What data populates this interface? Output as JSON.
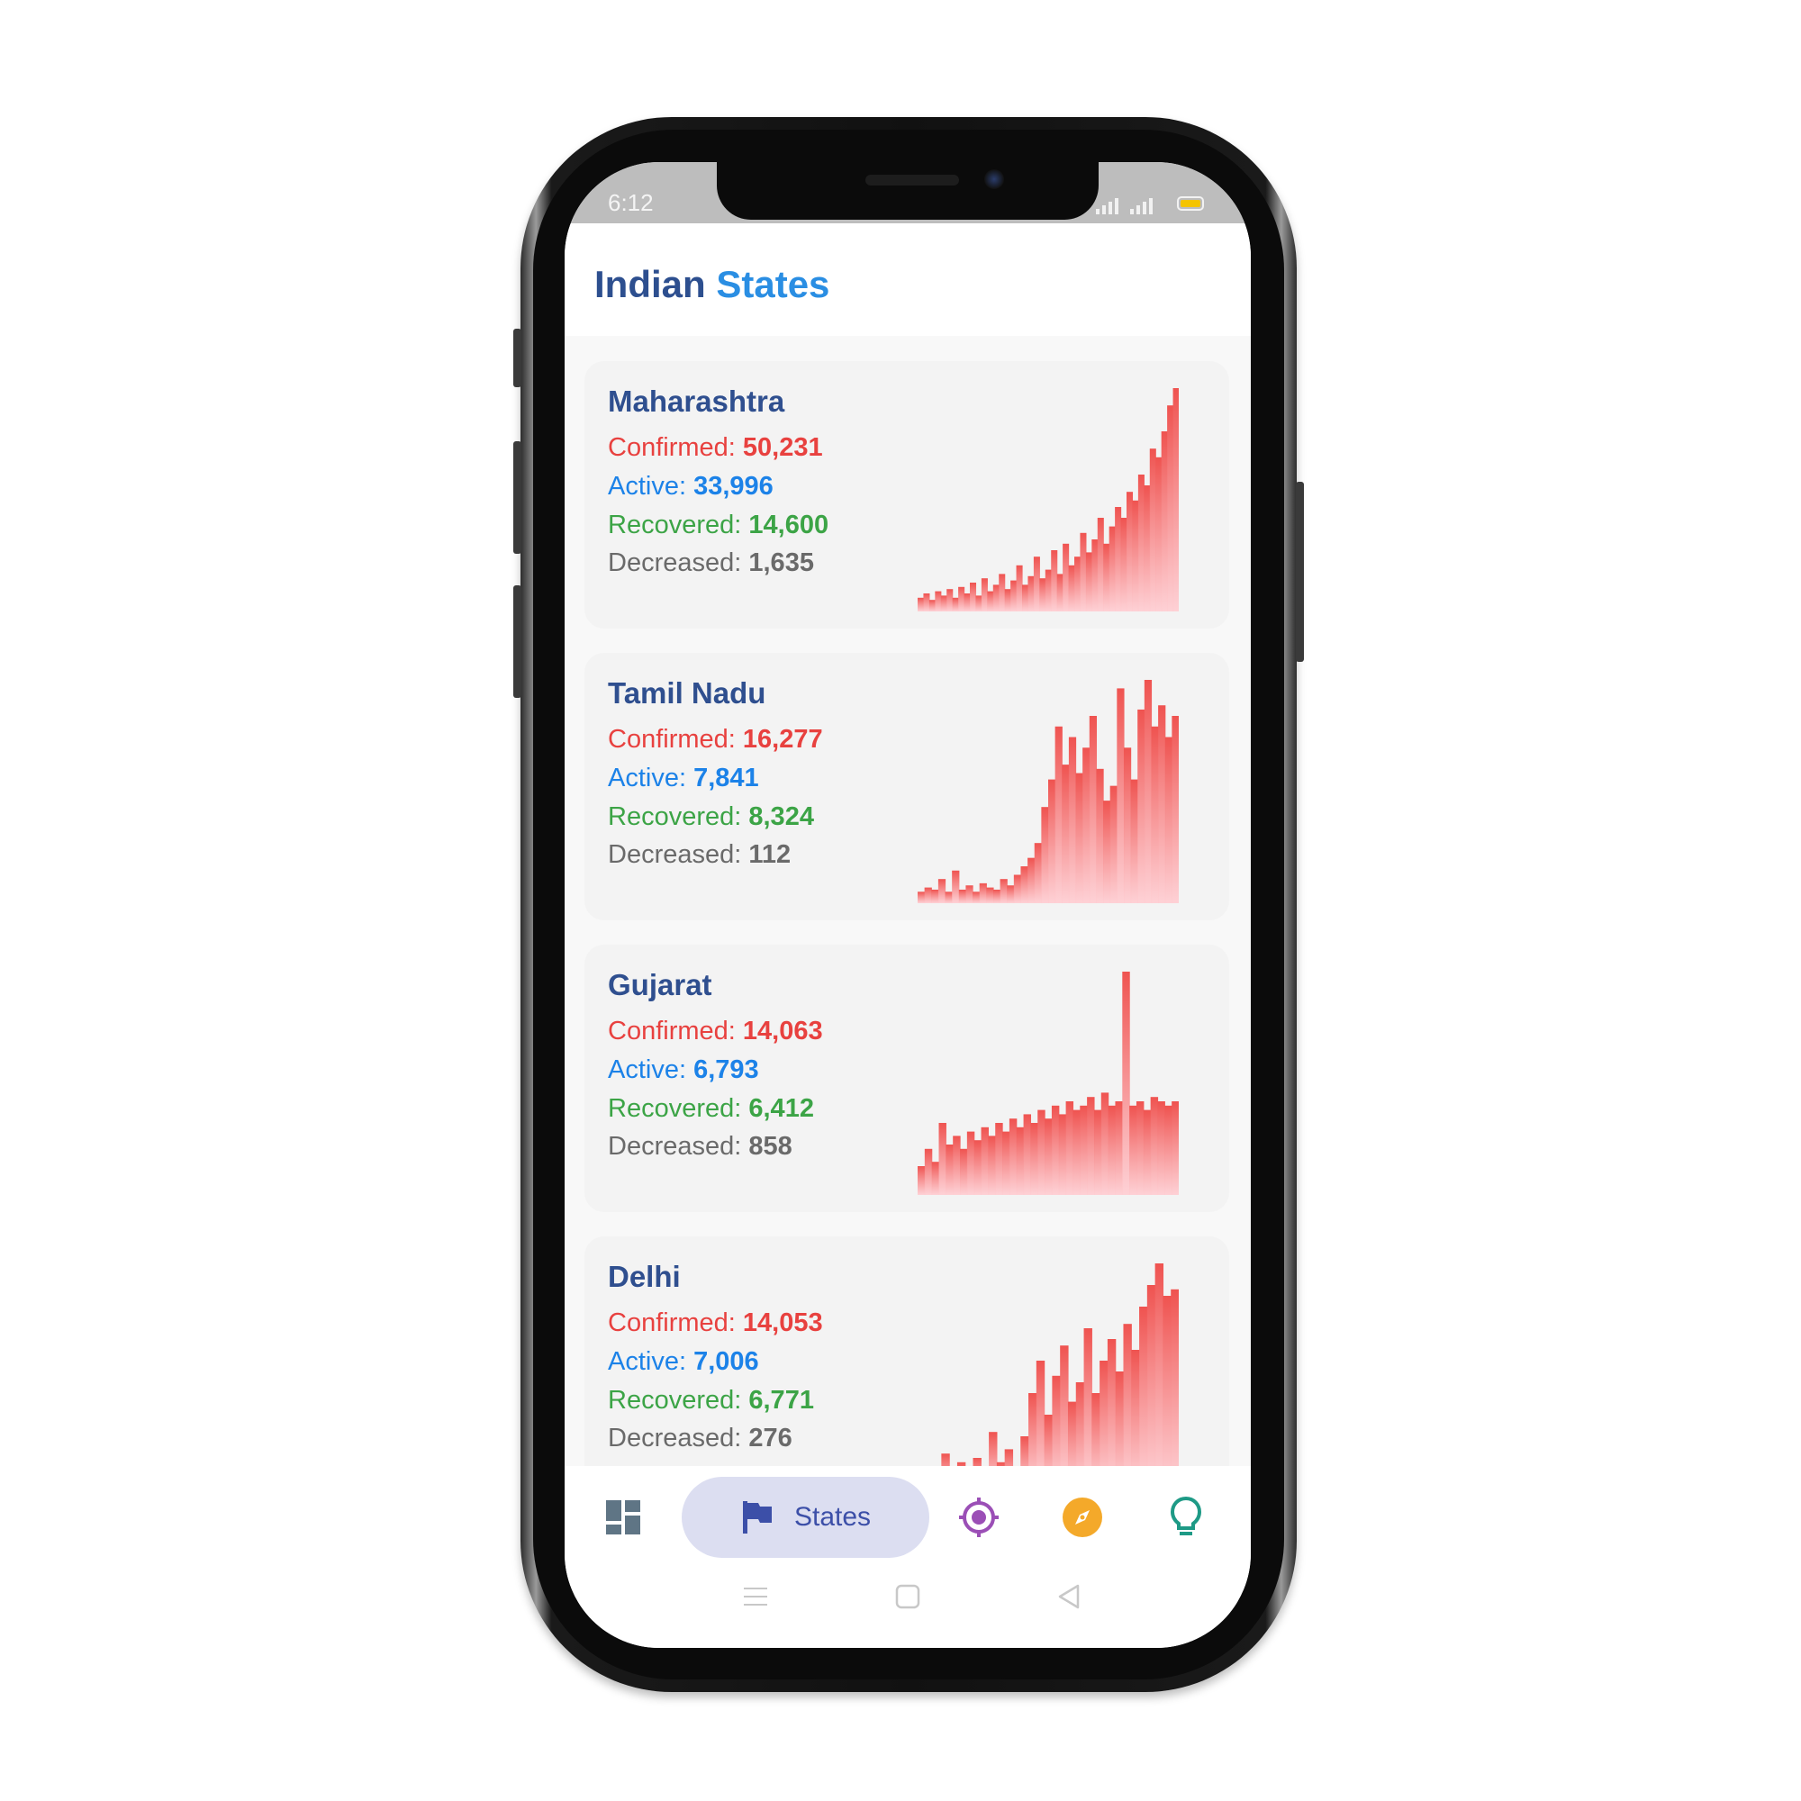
{
  "status_bar": {
    "time": "6:12"
  },
  "header": {
    "title_part1": "Indian",
    "title_part2": "States"
  },
  "labels": {
    "confirmed": "Confirmed:",
    "active": "Active:",
    "recovered": "Recovered:",
    "deceased": "Decreased:"
  },
  "states": [
    {
      "name": "Maharashtra",
      "confirmed": "50,231",
      "active": "33,996",
      "recovered": "14,600",
      "deceased": "1,635",
      "trend": [
        3,
        5,
        2,
        6,
        4,
        7,
        3,
        8,
        5,
        10,
        4,
        12,
        6,
        9,
        14,
        7,
        11,
        18,
        9,
        13,
        22,
        12,
        16,
        25,
        14,
        28,
        18,
        22,
        33,
        24,
        30,
        40,
        28,
        36,
        45,
        40,
        52,
        48,
        60,
        55,
        72,
        68,
        80,
        92,
        100
      ]
    },
    {
      "name": "Tamil Nadu",
      "confirmed": "16,277",
      "active": "7,841",
      "recovered": "8,324",
      "deceased": "112",
      "trend": [
        2,
        4,
        3,
        8,
        2,
        12,
        3,
        5,
        2,
        6,
        4,
        3,
        8,
        5,
        10,
        14,
        18,
        25,
        42,
        55,
        80,
        62,
        75,
        58,
        70,
        85,
        60,
        45,
        52,
        98,
        70,
        55,
        88,
        102,
        80,
        90,
        75,
        85
      ]
    },
    {
      "name": "Gujarat",
      "confirmed": "14,063",
      "active": "6,793",
      "recovered": "6,412",
      "deceased": "858",
      "trend": [
        10,
        18,
        12,
        30,
        20,
        24,
        18,
        26,
        22,
        28,
        24,
        30,
        26,
        32,
        28,
        34,
        30,
        36,
        32,
        38,
        34,
        40,
        36,
        38,
        42,
        36,
        44,
        38,
        40,
        100,
        38,
        40,
        36,
        42,
        40,
        38,
        40
      ]
    },
    {
      "name": "Delhi",
      "confirmed": "14,053",
      "active": "7,006",
      "recovered": "6,771",
      "deceased": "276",
      "trend": [
        2,
        3,
        2,
        12,
        4,
        8,
        3,
        10,
        6,
        22,
        8,
        14,
        4,
        20,
        40,
        55,
        30,
        48,
        62,
        36,
        45,
        70,
        40,
        55,
        65,
        50,
        72,
        60,
        80,
        90,
        100,
        85,
        88
      ]
    }
  ],
  "nav": {
    "states_label": "States"
  },
  "colors": {
    "confirmed": "#e8413f",
    "active": "#1c82e8",
    "recovered": "#3ca446",
    "deceased": "#6a6a6a",
    "title_dark": "#2d4f8f",
    "title_accent": "#2a8ee3"
  }
}
